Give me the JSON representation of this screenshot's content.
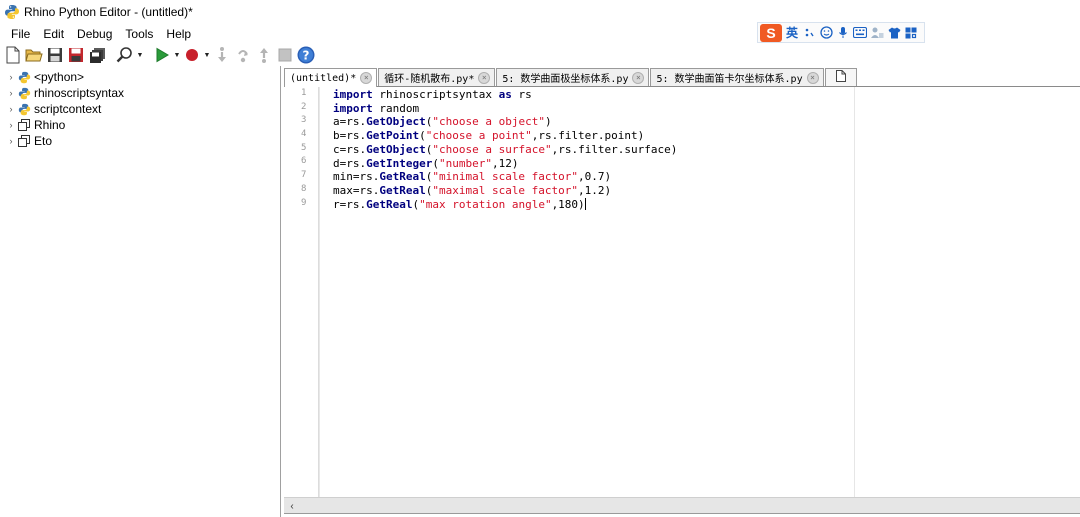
{
  "window": {
    "title": "Rhino Python Editor - (untitled)*"
  },
  "menu": {
    "items": [
      "File",
      "Edit",
      "Debug",
      "Tools",
      "Help"
    ]
  },
  "ime": {
    "lang": "英",
    "logo": "S"
  },
  "tree": {
    "items": [
      {
        "label": "<python>",
        "icon": "python-icon"
      },
      {
        "label": "rhinoscriptsyntax",
        "icon": "python-icon"
      },
      {
        "label": "scriptcontext",
        "icon": "python-icon"
      },
      {
        "label": "Rhino",
        "icon": "namespace-icon"
      },
      {
        "label": "Eto",
        "icon": "namespace-icon"
      }
    ]
  },
  "tabs": [
    {
      "label": "(untitled)*",
      "active": true
    },
    {
      "label": "循环-随机散布.py*",
      "active": false
    },
    {
      "label": "5: 数学曲面极坐标体系.py",
      "active": false
    },
    {
      "label": "5: 数学曲面笛卡尔坐标体系.py",
      "active": false
    }
  ],
  "editor": {
    "line_numbers": [
      "1",
      "2",
      "3",
      "4",
      "5",
      "6",
      "7",
      "8",
      "9"
    ],
    "lines": [
      [
        {
          "t": "kw",
          "v": "import"
        },
        {
          "t": "plain",
          "v": " rhinoscriptsyntax "
        },
        {
          "t": "kw",
          "v": "as"
        },
        {
          "t": "plain",
          "v": " rs"
        }
      ],
      [
        {
          "t": "kw",
          "v": "import"
        },
        {
          "t": "plain",
          "v": " random"
        }
      ],
      [
        {
          "t": "plain",
          "v": "a=rs."
        },
        {
          "t": "fn",
          "v": "GetObject"
        },
        {
          "t": "plain",
          "v": "("
        },
        {
          "t": "str",
          "v": "\"choose a object\""
        },
        {
          "t": "plain",
          "v": ")"
        }
      ],
      [
        {
          "t": "plain",
          "v": "b=rs."
        },
        {
          "t": "fn",
          "v": "GetPoint"
        },
        {
          "t": "plain",
          "v": "("
        },
        {
          "t": "str",
          "v": "\"choose a point\""
        },
        {
          "t": "plain",
          "v": ",rs.filter.point)"
        }
      ],
      [
        {
          "t": "plain",
          "v": "c=rs."
        },
        {
          "t": "fn",
          "v": "GetObject"
        },
        {
          "t": "plain",
          "v": "("
        },
        {
          "t": "str",
          "v": "\"choose a surface\""
        },
        {
          "t": "plain",
          "v": ",rs.filter.surface)"
        }
      ],
      [
        {
          "t": "plain",
          "v": "d=rs."
        },
        {
          "t": "fn",
          "v": "GetInteger"
        },
        {
          "t": "plain",
          "v": "("
        },
        {
          "t": "str",
          "v": "\"number\""
        },
        {
          "t": "plain",
          "v": ",12)"
        }
      ],
      [
        {
          "t": "plain",
          "v": "min=rs."
        },
        {
          "t": "fn",
          "v": "GetReal"
        },
        {
          "t": "plain",
          "v": "("
        },
        {
          "t": "str",
          "v": "\"minimal scale factor\""
        },
        {
          "t": "plain",
          "v": ",0.7)"
        }
      ],
      [
        {
          "t": "plain",
          "v": "max=rs."
        },
        {
          "t": "fn",
          "v": "GetReal"
        },
        {
          "t": "plain",
          "v": "("
        },
        {
          "t": "str",
          "v": "\"maximal scale factor\""
        },
        {
          "t": "plain",
          "v": ",1.2)"
        }
      ],
      [
        {
          "t": "plain",
          "v": "r=rs."
        },
        {
          "t": "fn",
          "v": "GetReal"
        },
        {
          "t": "plain",
          "v": "("
        },
        {
          "t": "str",
          "v": "\"max rotation angle\""
        },
        {
          "t": "plain",
          "v": ",180)"
        }
      ]
    ]
  },
  "colors": {
    "keyword": "#00007f",
    "string": "#d4122a",
    "ime_logo": "#f05a23"
  }
}
